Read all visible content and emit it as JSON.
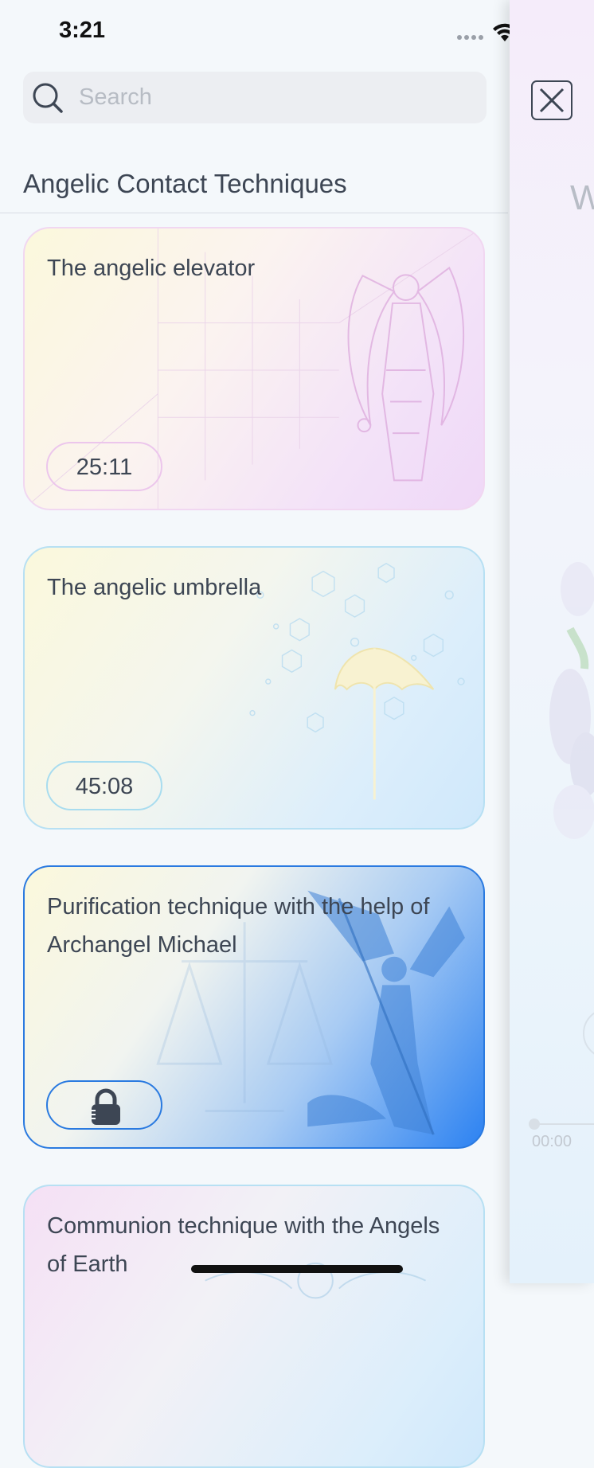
{
  "status_bar": {
    "time": "3:21"
  },
  "search": {
    "placeholder": "Search",
    "value": ""
  },
  "section": {
    "title": "Angelic Contact Techniques"
  },
  "cards": [
    {
      "title": "The angelic elevator",
      "duration": "25:11",
      "locked": false,
      "accent": "#efd8f7"
    },
    {
      "title": "The angelic umbrella",
      "duration": "45:08",
      "locked": false,
      "accent": "#cfe8fb"
    },
    {
      "title": "Purification technique with the help of Archangel Michael",
      "duration": "",
      "locked": true,
      "accent": "#2c82f2"
    },
    {
      "title": "Communion technique with the Angels of Earth",
      "duration": "",
      "locked": false,
      "accent": "#cfe8fb"
    }
  ],
  "player_panel": {
    "heading_fragment": "W",
    "elapsed": "00:00"
  },
  "icons": {
    "search": "search-icon",
    "close": "close-icon",
    "lock": "lock-icon",
    "wifi": "wifi-icon",
    "battery": "battery-icon"
  }
}
